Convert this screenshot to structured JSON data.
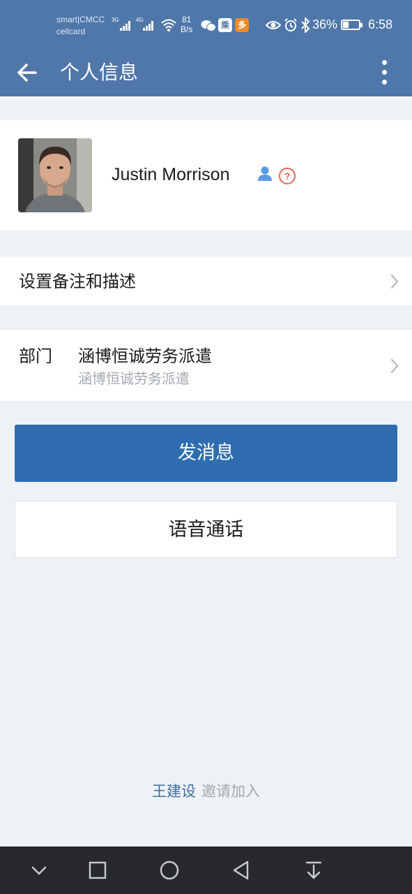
{
  "status_bar": {
    "carrier_line1": "smart|CMCC",
    "carrier_line2": "cellcard",
    "signal1_label": "3G",
    "signal2_label": "4G",
    "net_speed_value": "81",
    "net_speed_unit": "B/s",
    "battery_percent": "36%",
    "battery_level": 0.36,
    "time": "6:58",
    "icons": [
      "wechat-icon",
      "app-icon-blue",
      "app-icon-orange",
      "eye-icon",
      "alarm-icon",
      "bluetooth-icon"
    ]
  },
  "header": {
    "title": "个人信息"
  },
  "profile": {
    "name": "Justin Morrison"
  },
  "remark_row": {
    "label": "设置备注和描述"
  },
  "department_row": {
    "label": "部门",
    "value": "涵博恒诚劳务派遣",
    "sub_value": "涵博恒诚劳务派遣"
  },
  "buttons": {
    "send_message": "发消息",
    "voice_call": "语音通话"
  },
  "footer": {
    "inviter_name": "王建设",
    "invite_text": "邀请加入"
  },
  "colors": {
    "header_bg": "#4f77aa",
    "primary_button": "#2f6db0",
    "page_bg": "#eff2f5",
    "link_blue": "#3c6ea5",
    "help_red": "#e06a55",
    "navbar_bg": "#27292d"
  }
}
